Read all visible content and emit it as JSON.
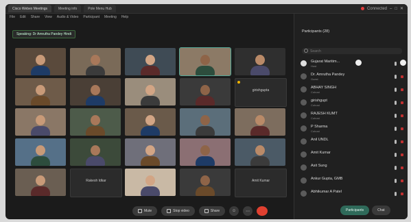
{
  "window": {
    "tabs": [
      {
        "label": "Cisco Webex Meetings"
      },
      {
        "label": "Meeting info"
      },
      {
        "label": "Pole Menu Hub"
      }
    ],
    "recording_label": "Connected"
  },
  "menu": [
    "File",
    "Edit",
    "Share",
    "View",
    "Audio & Video",
    "Participant",
    "Meeting",
    "Help"
  ],
  "speaking": "Speaking: Dr Amrutha Pandey Hindi",
  "grid": {
    "name_tiles": [
      "girishgupta",
      "Rakesh Idkar",
      "Amit Kumar"
    ]
  },
  "participants": {
    "title": "Participants (28)",
    "search_placeholder": "Search",
    "list": [
      {
        "name": "Gujarat Maritim...",
        "role": "Host"
      },
      {
        "name": "Dr. Amrutha Pandey",
        "role": "Guest"
      },
      {
        "name": "ABHAY SINGH",
        "role": "Cohost"
      },
      {
        "name": "girishgupt",
        "role": "Cohost"
      },
      {
        "name": "RAJESH KUMT",
        "role": "Cohost"
      },
      {
        "name": "P Sharma",
        "role": "Cohost"
      },
      {
        "name": "Anil UNDL",
        "role": ""
      },
      {
        "name": "Amit Kumar",
        "role": ""
      },
      {
        "name": "Asit Sung",
        "role": ""
      },
      {
        "name": "Ankur Gupta, GMB",
        "role": ""
      },
      {
        "name": "Abhikumar A Patel",
        "role": ""
      }
    ]
  },
  "controls": {
    "mute": "Mute",
    "stop_video": "Stop video",
    "share": "Share",
    "participants": "Participants",
    "chat": "Chat"
  },
  "colors": {
    "accent": "#2f6a5a",
    "leave": "#e04030"
  }
}
